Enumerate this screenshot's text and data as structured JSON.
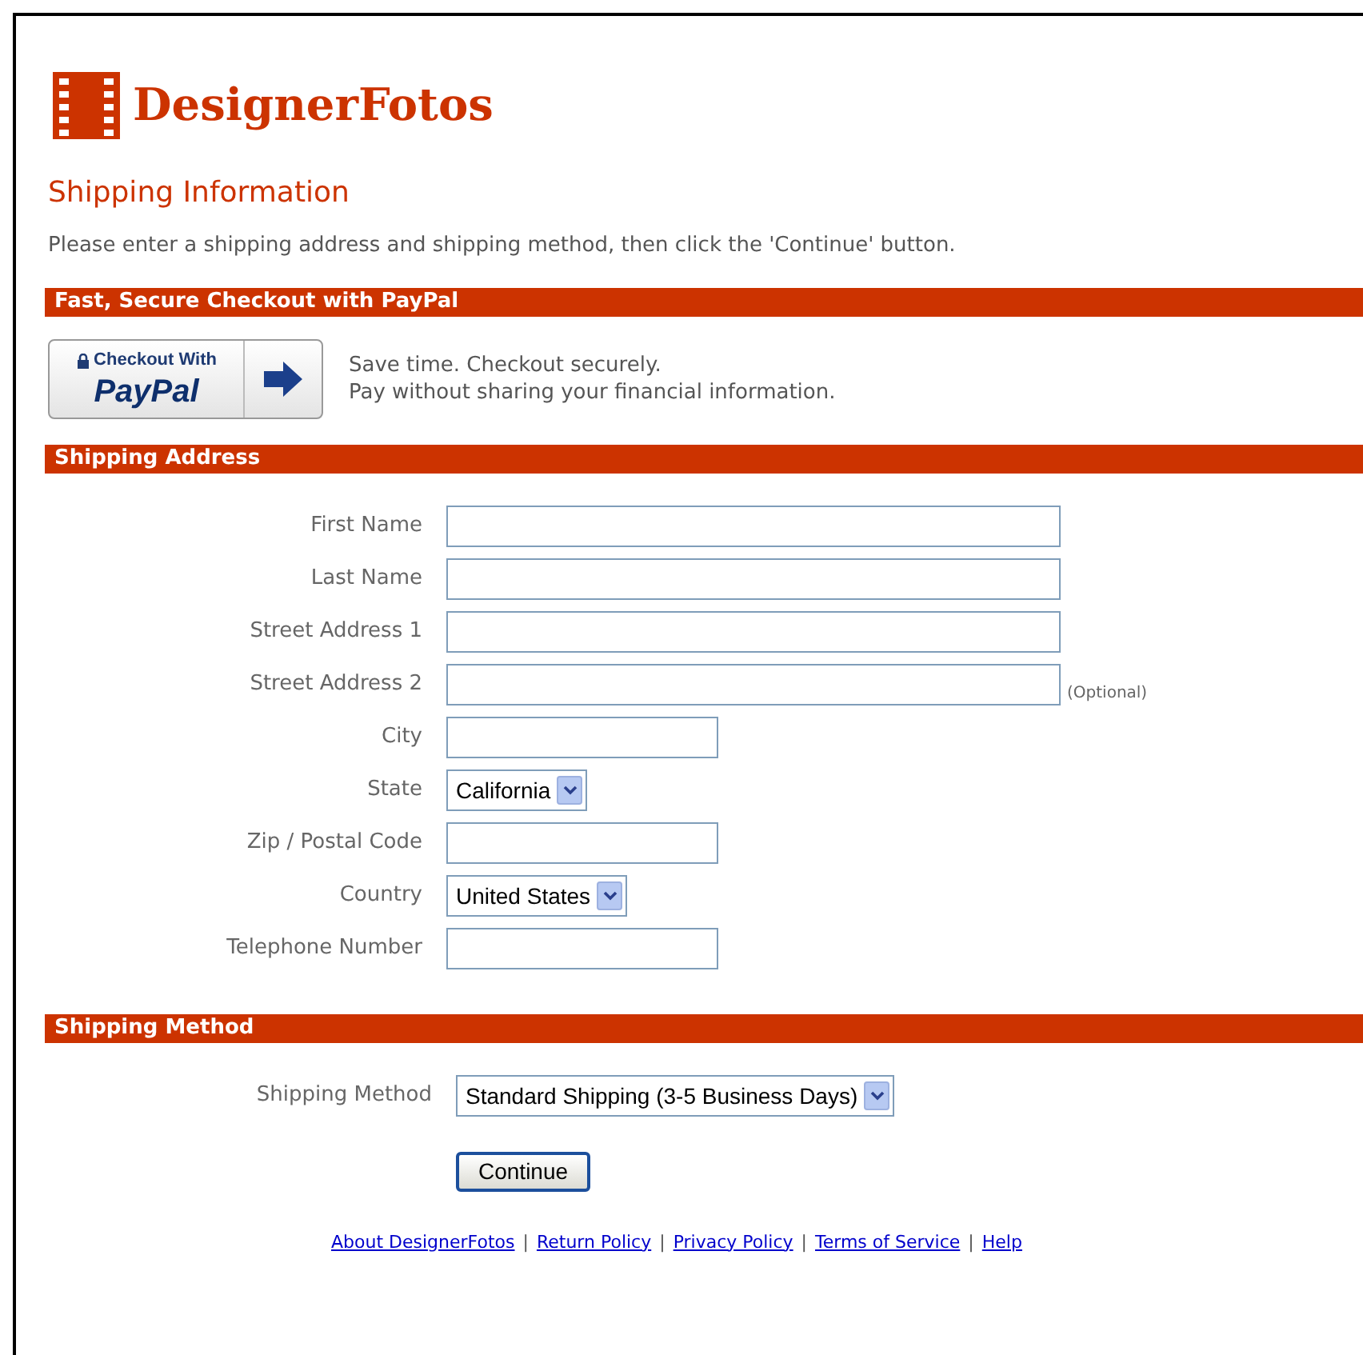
{
  "logo": {
    "text": "DesignerFotos"
  },
  "heading": "Shipping Information",
  "intro": "Please enter a shipping address and shipping method, then click the 'Continue' button.",
  "paypal_section": {
    "title": "Fast, Secure Checkout with PayPal",
    "button": {
      "top": "Checkout With",
      "brand": "PayPal"
    },
    "lines": [
      "Save time. Checkout securely.",
      "Pay without sharing your financial information."
    ]
  },
  "address_section": {
    "title": "Shipping Address",
    "fields": [
      {
        "label": "First Name",
        "kind": "long-text"
      },
      {
        "label": "Last Name",
        "kind": "long-text"
      },
      {
        "label": "Street Address 1",
        "kind": "long-text"
      },
      {
        "label": "Street Address 2",
        "kind": "long-text",
        "note": "(Optional)"
      },
      {
        "label": "City",
        "kind": "short-text"
      },
      {
        "label": "State",
        "kind": "select",
        "value": "California"
      },
      {
        "label": "Zip / Postal Code",
        "kind": "short-text"
      },
      {
        "label": "Country",
        "kind": "select",
        "value": "United States"
      },
      {
        "label": "Telephone Number",
        "kind": "short-text"
      }
    ]
  },
  "method_section": {
    "title": "Shipping Method",
    "fields": [
      {
        "label": "Shipping Method",
        "kind": "select",
        "value": "Standard Shipping (3-5 Business Days)"
      }
    ]
  },
  "continue_button": "Continue",
  "footer": [
    {
      "kind": "link",
      "text": "About DesignerFotos"
    },
    {
      "kind": "separator",
      "text": "|"
    },
    {
      "kind": "link",
      "text": "Return Policy"
    },
    {
      "kind": "separator",
      "text": "|"
    },
    {
      "kind": "link",
      "text": "Privacy Policy"
    },
    {
      "kind": "separator",
      "text": "|"
    },
    {
      "kind": "link",
      "text": "Terms of Service"
    },
    {
      "kind": "separator",
      "text": "|"
    },
    {
      "kind": "link",
      "text": "Help"
    }
  ]
}
